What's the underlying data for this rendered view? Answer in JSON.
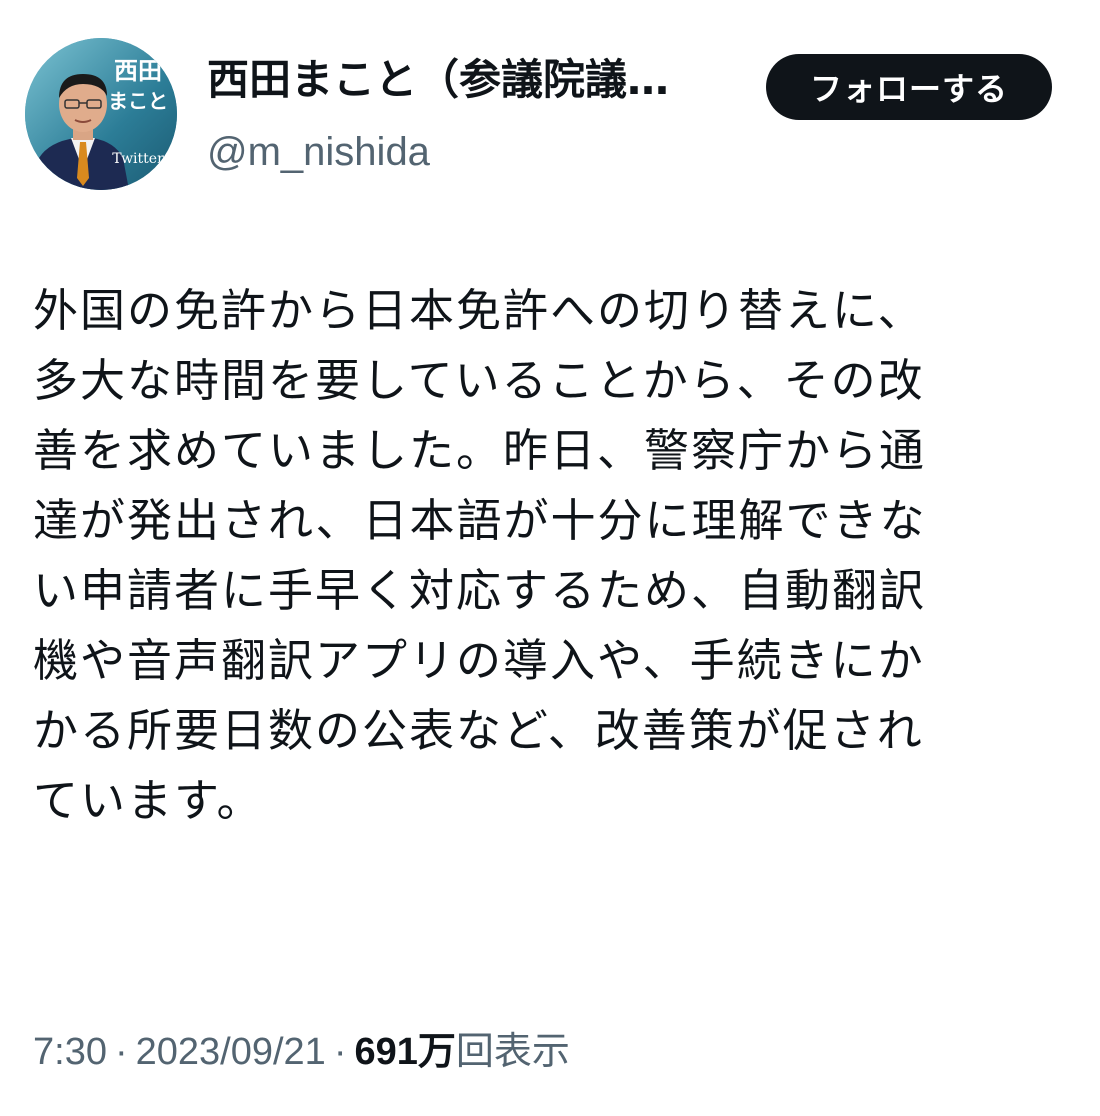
{
  "author": {
    "avatar_label_line1": "西田",
    "avatar_label_line2": "まこと",
    "avatar_label_line3": "Twitter",
    "display_name": "西田まこと（参議院議…",
    "handle": "@m_nishida"
  },
  "actions": {
    "follow_label": "フォローする"
  },
  "tweet": {
    "lines": [
      "外国の免許から日本免許への切り替えに、",
      "多大な時間を要していることから、その改",
      "善を求めていました。昨日、警察庁から通",
      "達が発出され、日本語が十分に理解できな",
      "い申請者に手早く対応するため、自動翻訳",
      "機や音声翻訳アプリの導入や、手続きにか",
      "かる所要日数の公表など、改善策が促され",
      "ています。"
    ]
  },
  "meta": {
    "time": "7:30",
    "separator": "·",
    "date": "2023/09/21",
    "views_count": "691万",
    "views_label": "回表示"
  }
}
